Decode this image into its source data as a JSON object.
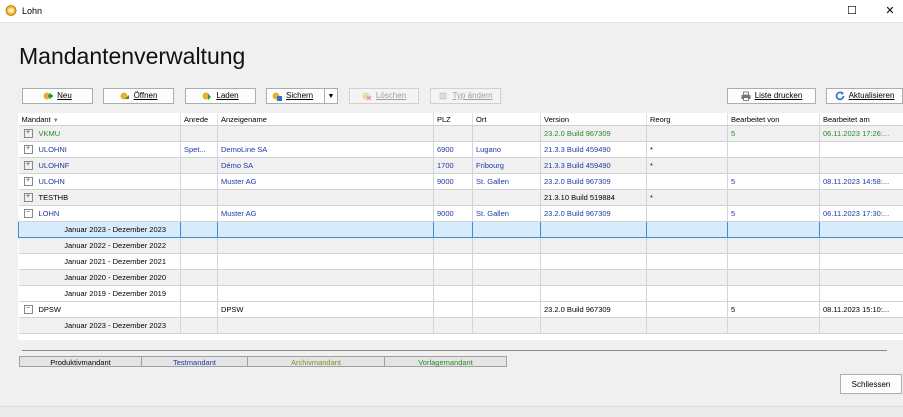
{
  "window": {
    "title": "Lohn",
    "maximize_symbol": "☐",
    "close_symbol": "✕"
  },
  "heading": "Mandantenverwaltung",
  "toolbar": {
    "neu": "Neu",
    "oeffnen": "Öffnen",
    "laden": "Laden",
    "sichern": "Sichern",
    "loeschen": "Löschen",
    "typ_aendern": "Typ ändern",
    "liste_drucken": "Liste drucken",
    "aktualisieren": "Aktualisieren"
  },
  "columns": [
    "Mandant",
    "Anrede",
    "Anzeigename",
    "PLZ",
    "Ort",
    "Version",
    "Reorg",
    "Bearbeitet von",
    "Bearbeitet am"
  ],
  "rows": [
    {
      "mandant": "VKMU",
      "anrede": "",
      "anzeigename": "",
      "plz": "",
      "ort": "",
      "version": "23.2.0 Build 967309",
      "reorg": "",
      "von": "5",
      "am": "06.11.2023 17:26:...",
      "toggle": "⊞",
      "level": 0,
      "color": "green",
      "alt": true
    },
    {
      "mandant": "ULOHNI",
      "anrede": "Spet...",
      "anzeigename": "DemoLine SA",
      "plz": "6900",
      "ort": "Lugano",
      "version": "21.3.3 Build 459490",
      "reorg": "*",
      "von": "",
      "am": "",
      "toggle": "⊞",
      "level": 0,
      "color": "blue",
      "alt": false
    },
    {
      "mandant": "ULOHNF",
      "anrede": "",
      "anzeigename": "Démo SA",
      "plz": "1700",
      "ort": "Fribourg",
      "version": "21.3.3 Build 459490",
      "reorg": "*",
      "von": "",
      "am": "",
      "toggle": "⊞",
      "level": 0,
      "color": "blue",
      "alt": true
    },
    {
      "mandant": "ULOHN",
      "anrede": "",
      "anzeigename": "Muster AG",
      "plz": "9000",
      "ort": "St. Gallen",
      "version": "23.2.0 Build 967309",
      "reorg": "",
      "von": "5",
      "am": "08.11.2023 14:58:...",
      "toggle": "⊞",
      "level": 0,
      "color": "blue",
      "alt": false
    },
    {
      "mandant": "TESTHB",
      "anrede": "",
      "anzeigename": "",
      "plz": "",
      "ort": "",
      "version": "21.3.10 Build 519884",
      "reorg": "*",
      "von": "",
      "am": "",
      "toggle": "⊞",
      "level": 0,
      "color": "black",
      "alt": true
    },
    {
      "mandant": "LOHN",
      "anrede": "",
      "anzeigename": "Muster AG",
      "plz": "9000",
      "ort": "St. Gallen",
      "version": "23.2.0 Build 967309",
      "reorg": "",
      "von": "5",
      "am": "06.11.2023 17:30:...",
      "toggle": "⊟",
      "level": 0,
      "color": "blue",
      "alt": false
    },
    {
      "mandant": "Januar 2023 - Dezember 2023",
      "anrede": "",
      "anzeigename": "",
      "plz": "",
      "ort": "",
      "version": "",
      "reorg": "",
      "von": "",
      "am": "",
      "toggle": "",
      "level": 1,
      "color": "black",
      "alt": false,
      "selected": true
    },
    {
      "mandant": "Januar 2022 - Dezember 2022",
      "anrede": "",
      "anzeigename": "",
      "plz": "",
      "ort": "",
      "version": "",
      "reorg": "",
      "von": "",
      "am": "",
      "toggle": "",
      "level": 1,
      "color": "black",
      "alt": true
    },
    {
      "mandant": "Januar 2021 - Dezember 2021",
      "anrede": "",
      "anzeigename": "",
      "plz": "",
      "ort": "",
      "version": "",
      "reorg": "",
      "von": "",
      "am": "",
      "toggle": "",
      "level": 1,
      "color": "black",
      "alt": false
    },
    {
      "mandant": "Januar 2020 - Dezember 2020",
      "anrede": "",
      "anzeigename": "",
      "plz": "",
      "ort": "",
      "version": "",
      "reorg": "",
      "von": "",
      "am": "",
      "toggle": "",
      "level": 1,
      "color": "black",
      "alt": true
    },
    {
      "mandant": "Januar 2019 - Dezember 2019",
      "anrede": "",
      "anzeigename": "",
      "plz": "",
      "ort": "",
      "version": "",
      "reorg": "",
      "von": "",
      "am": "",
      "toggle": "",
      "level": 1,
      "color": "black",
      "alt": false
    },
    {
      "mandant": "DPSW",
      "anrede": "",
      "anzeigename": "DPSW",
      "plz": "",
      "ort": "",
      "version": "23.2.0 Build 967309",
      "reorg": "",
      "von": "5",
      "am": "08.11.2023 15:10:...",
      "toggle": "⊟",
      "level": 0,
      "color": "black",
      "alt": false
    },
    {
      "mandant": "Januar 2023 - Dezember 2023",
      "anrede": "",
      "anzeigename": "",
      "plz": "",
      "ort": "",
      "version": "",
      "reorg": "",
      "von": "",
      "am": "",
      "toggle": "",
      "level": 1,
      "color": "black",
      "alt": true
    }
  ],
  "legend": [
    {
      "label": "Produktivmandant",
      "color": "#000000"
    },
    {
      "label": "Testmandant",
      "color": "#1f3aa6"
    },
    {
      "label": "Archivmandant",
      "color": "#8a8a2a"
    },
    {
      "label": "Vorlagemandant",
      "color": "#2a8a2a"
    }
  ],
  "close_button": "Schliessen"
}
